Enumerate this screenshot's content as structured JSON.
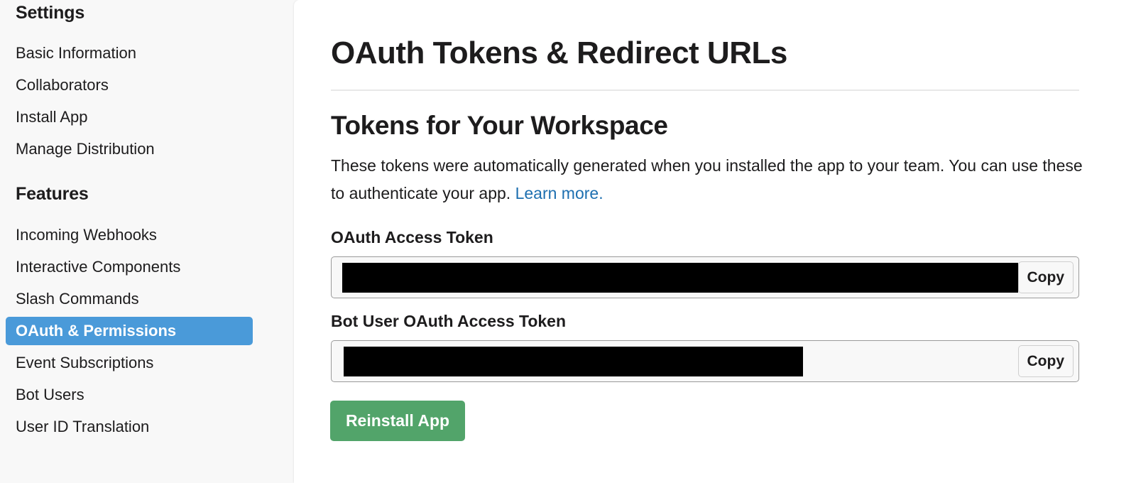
{
  "sidebar": {
    "settings_heading": "Settings",
    "settings_items": [
      {
        "label": "Basic Information"
      },
      {
        "label": "Collaborators"
      },
      {
        "label": "Install App"
      },
      {
        "label": "Manage Distribution"
      }
    ],
    "features_heading": "Features",
    "features_items": [
      {
        "label": "Incoming Webhooks"
      },
      {
        "label": "Interactive Components"
      },
      {
        "label": "Slash Commands"
      },
      {
        "label": "OAuth & Permissions",
        "active": true
      },
      {
        "label": "Event Subscriptions"
      },
      {
        "label": "Bot Users"
      },
      {
        "label": "User ID Translation"
      }
    ]
  },
  "main": {
    "page_title": "OAuth Tokens & Redirect URLs",
    "section_title": "Tokens for Your Workspace",
    "description": "These tokens were automatically generated when you installed the app to your team. You can use these to authenticate your app.",
    "learn_more_link": "Learn more.",
    "oauth_token": {
      "label": "OAuth Access Token",
      "value": "[redacted]",
      "copy_label": "Copy"
    },
    "bot_token": {
      "label": "Bot User OAuth Access Token",
      "value": "[redacted]",
      "copy_label": "Copy"
    },
    "reinstall_label": "Reinstall App"
  },
  "colors": {
    "active_nav": "#4a9ad9",
    "link": "#1d6fb0",
    "reinstall_button": "#52a46a"
  }
}
